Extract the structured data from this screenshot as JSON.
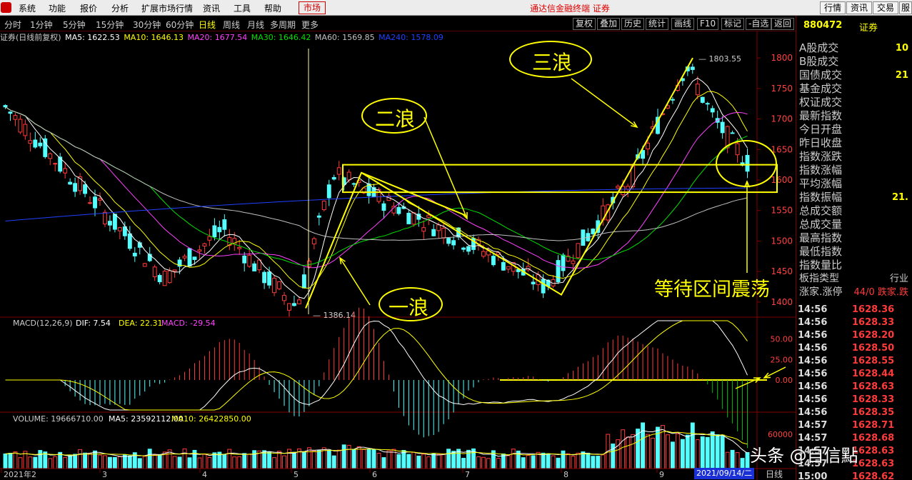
{
  "menu": [
    "系统",
    "功能",
    "报价",
    "分析",
    "扩展市场行情",
    "资讯",
    "工具",
    "帮助"
  ],
  "market_label": "市场",
  "center_title": "通达信金融终端  证券",
  "right_buttons": [
    "行情",
    "资讯",
    "交易",
    "服务"
  ],
  "periods": [
    "分时",
    "1分钟",
    "5分钟",
    "15分钟",
    "30分钟",
    "60分钟",
    "日线",
    "周线",
    "月线",
    "多周期",
    "更多"
  ],
  "active_period": "日线",
  "tools": [
    "复权",
    "叠加",
    "历史",
    "统计",
    "画线",
    "F10",
    "标记",
    "-自选",
    "返回"
  ],
  "ma_info": {
    "name": "证券(日线前复权)",
    "ma5": "MA5: 1622.53",
    "ma10": "MA10: 1646.13",
    "ma20": "MA20: 1677.54",
    "ma30": "MA30: 1646.42",
    "ma60": "MA60: 1569.85",
    "ma240": "MA240: 1578.09"
  },
  "macd_info": {
    "label": "MACD(12,26,9)",
    "dif": "DIF: 7.54",
    "dea": "DEA: 22.31",
    "macd": "MACD: -29.54"
  },
  "vol_info": {
    "label": "VOLUME: 19666710.00",
    "ma5": "MA5: 23592112.00",
    "ma10": "MA10: 26422850.00"
  },
  "colors": {
    "up": "#ff3a3a",
    "down": "#54ffff",
    "ma5": "#ffffff",
    "ma10": "#ffff00",
    "ma20": "#ff40ff",
    "ma30": "#00e000",
    "ma60": "#c0c0c0",
    "ma240": "#2040ff",
    "annotation": "#ffff00"
  },
  "price_axis": [
    "1800",
    "1750",
    "1700",
    "1650",
    "1600",
    "1550",
    "1500",
    "1450",
    "1400"
  ],
  "macd_axis": [
    "50.00",
    "25.00",
    "0.00"
  ],
  "vol_axis": [
    "60000"
  ],
  "months": [
    "2021年2",
    "3",
    "4",
    "5",
    "6",
    "7",
    "8",
    "9"
  ],
  "annotations": {
    "high_label": "1803.55",
    "low_label": "1386.14",
    "wave1": "一浪",
    "wave2": "二浪",
    "wave3": "三浪",
    "wait": "等待区间震荡"
  },
  "right_panel": {
    "code": "880472",
    "name": "证券",
    "rows": [
      {
        "label": "A股成交",
        "value": "10"
      },
      {
        "label": "B股成交",
        "value": ""
      },
      {
        "label": "国债成交",
        "value": "21"
      },
      {
        "label": "基金成交",
        "value": ""
      },
      {
        "label": "权证成交",
        "value": ""
      },
      {
        "label": "最新指数",
        "value": ""
      },
      {
        "label": "今日开盘",
        "value": ""
      },
      {
        "label": "昨日收盘",
        "value": ""
      },
      {
        "label": "指数涨跌",
        "value": ""
      },
      {
        "label": "指数涨幅",
        "value": ""
      },
      {
        "label": "平均涨幅",
        "value": ""
      },
      {
        "label": "指数振幅",
        "value": "21."
      },
      {
        "label": "总成交额",
        "value": ""
      },
      {
        "label": "总成交量",
        "value": ""
      },
      {
        "label": "最高指数",
        "value": ""
      },
      {
        "label": "最低指数",
        "value": ""
      },
      {
        "label": "指数量比",
        "value": ""
      },
      {
        "label": "板指类型",
        "value": "行业"
      },
      {
        "label": "涨家.涨停",
        "value": "44/0 跌家.跌"
      }
    ],
    "ticks": [
      {
        "time": "14:56",
        "price": "1628.36"
      },
      {
        "time": "14:56",
        "price": "1628.33"
      },
      {
        "time": "14:56",
        "price": "1628.20"
      },
      {
        "time": "14:56",
        "price": "1628.50"
      },
      {
        "time": "14:56",
        "price": "1628.55"
      },
      {
        "time": "14:56",
        "price": "1628.44"
      },
      {
        "time": "14:56",
        "price": "1628.63"
      },
      {
        "time": "14:56",
        "price": "1628.33"
      },
      {
        "time": "14:56",
        "price": "1628.35"
      },
      {
        "time": "14:57",
        "price": "1628.71"
      },
      {
        "time": "14:57",
        "price": "1628.68"
      },
      {
        "time": "14:57",
        "price": "1628.63"
      },
      {
        "time": "14:57",
        "price": "1628.63"
      },
      {
        "time": "15:00",
        "price": "1628.62"
      }
    ]
  },
  "date_tag": "2021/09/14/二",
  "daily_tag": "日线",
  "watermark": "头条 @自信點",
  "chart_data": {
    "type": "candlestick",
    "x_range": [
      "2021-01",
      "2021-09-14"
    ],
    "ylim": [
      1380,
      1820
    ],
    "low": 1386.14,
    "high": 1803.55,
    "key_points": [
      {
        "label": "start",
        "x": "2021-01",
        "y": 1720
      },
      {
        "label": "low (一浪 start)",
        "x": "2021-05",
        "y": 1386.14
      },
      {
        "label": "一浪 top",
        "x": "2021-06",
        "y": 1615
      },
      {
        "label": "二浪 bottom",
        "x": "2021-08",
        "y": 1418
      },
      {
        "label": "high (三浪 top)",
        "x": "2021-09",
        "y": 1803.55
      },
      {
        "label": "last",
        "x": "2021-09-14",
        "y": 1628.62
      }
    ],
    "box_range": [
      1580,
      1625
    ],
    "macd_ylim": [
      -40,
      60
    ],
    "vol_ylim": [
      0,
      70000000
    ]
  }
}
